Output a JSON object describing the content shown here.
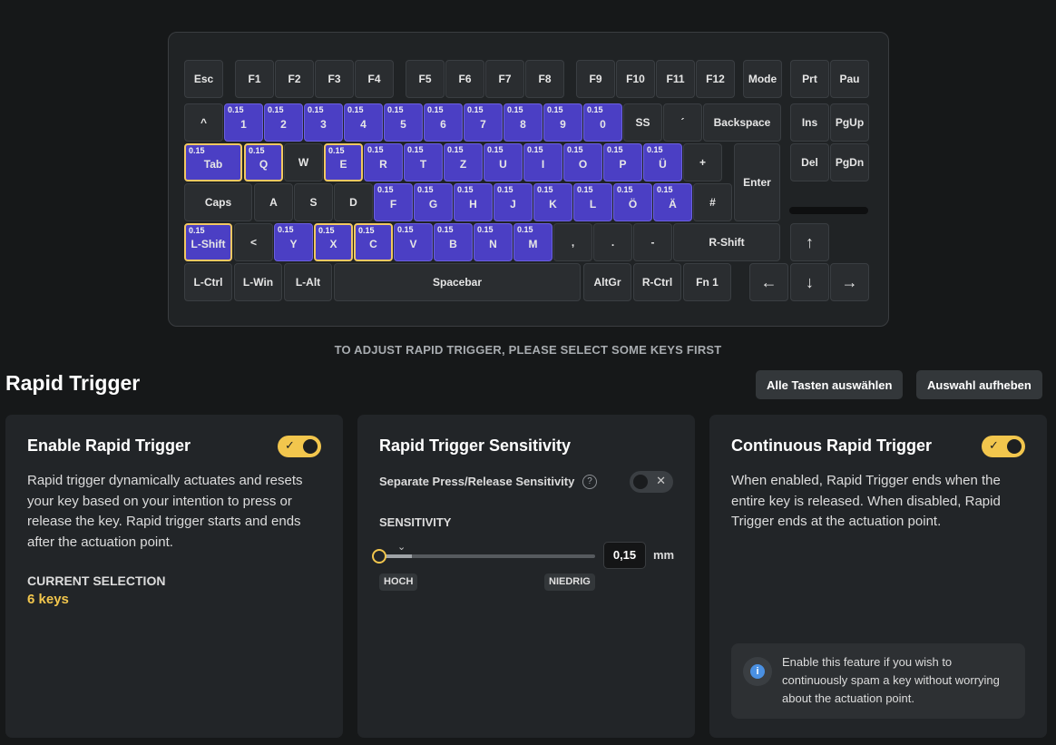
{
  "keyboard": {
    "rows": [
      [
        {
          "t": "Esc"
        },
        {
          "t": "F1"
        },
        {
          "t": "F2"
        },
        {
          "t": "F3"
        },
        {
          "t": "F4"
        },
        {
          "t": "F5"
        },
        {
          "t": "F6"
        },
        {
          "t": "F7"
        },
        {
          "t": "F8"
        },
        {
          "t": "F9"
        },
        {
          "t": "F10"
        },
        {
          "t": "F11"
        },
        {
          "t": "F12"
        },
        {
          "t": "Mode"
        },
        {
          "t": "Prt"
        },
        {
          "t": "Pau"
        }
      ],
      [
        {
          "t": "^"
        },
        {
          "t": "1",
          "v": "0.15"
        },
        {
          "t": "2",
          "v": "0.15"
        },
        {
          "t": "3",
          "v": "0.15"
        },
        {
          "t": "4",
          "v": "0.15"
        },
        {
          "t": "5",
          "v": "0.15"
        },
        {
          "t": "6",
          "v": "0.15"
        },
        {
          "t": "7",
          "v": "0.15"
        },
        {
          "t": "8",
          "v": "0.15"
        },
        {
          "t": "9",
          "v": "0.15"
        },
        {
          "t": "0",
          "v": "0.15"
        },
        {
          "t": "SS"
        },
        {
          "t": "´"
        },
        {
          "t": "Backspace"
        },
        {
          "t": "Ins"
        },
        {
          "t": "PgUp"
        }
      ],
      [
        {
          "t": "Tab",
          "v": "0.15",
          "s": true
        },
        {
          "t": "Q",
          "v": "0.15",
          "s": true
        },
        {
          "t": "W"
        },
        {
          "t": "E",
          "v": "0.15",
          "s": true
        },
        {
          "t": "R",
          "v": "0.15"
        },
        {
          "t": "T",
          "v": "0.15"
        },
        {
          "t": "Z",
          "v": "0.15"
        },
        {
          "t": "U",
          "v": "0.15"
        },
        {
          "t": "I",
          "v": "0.15"
        },
        {
          "t": "O",
          "v": "0.15"
        },
        {
          "t": "P",
          "v": "0.15"
        },
        {
          "t": "Ü",
          "v": "0.15"
        },
        {
          "t": "+"
        },
        {
          "t": "Enter"
        },
        {
          "t": "Del"
        },
        {
          "t": "PgDn"
        }
      ],
      [
        {
          "t": "Caps"
        },
        {
          "t": "A"
        },
        {
          "t": "S"
        },
        {
          "t": "D"
        },
        {
          "t": "F",
          "v": "0.15"
        },
        {
          "t": "G",
          "v": "0.15"
        },
        {
          "t": "H",
          "v": "0.15"
        },
        {
          "t": "J",
          "v": "0.15"
        },
        {
          "t": "K",
          "v": "0.15"
        },
        {
          "t": "L",
          "v": "0.15"
        },
        {
          "t": "Ö",
          "v": "0.15"
        },
        {
          "t": "Ä",
          "v": "0.15"
        },
        {
          "t": "#"
        }
      ],
      [
        {
          "t": "L-Shift",
          "v": "0.15",
          "s": true
        },
        {
          "t": "<"
        },
        {
          "t": "Y",
          "v": "0.15"
        },
        {
          "t": "X",
          "v": "0.15",
          "s": true
        },
        {
          "t": "C",
          "v": "0.15",
          "s": true
        },
        {
          "t": "V",
          "v": "0.15"
        },
        {
          "t": "B",
          "v": "0.15"
        },
        {
          "t": "N",
          "v": "0.15"
        },
        {
          "t": "M",
          "v": "0.15"
        },
        {
          "t": ","
        },
        {
          "t": "."
        },
        {
          "t": "-"
        },
        {
          "t": "R-Shift"
        },
        {
          "t": "↑"
        }
      ],
      [
        {
          "t": "L-Ctrl"
        },
        {
          "t": "L-Win"
        },
        {
          "t": "L-Alt"
        },
        {
          "t": "Spacebar"
        },
        {
          "t": "AltGr"
        },
        {
          "t": "R-Ctrl"
        },
        {
          "t": "Fn 1"
        },
        {
          "t": "←"
        },
        {
          "t": "↓"
        },
        {
          "t": "→"
        }
      ]
    ]
  },
  "notice": "TO ADJUST RAPID TRIGGER, PLEASE SELECT SOME KEYS FIRST",
  "header": {
    "title": "Rapid Trigger",
    "select_all": "Alle Tasten auswählen",
    "clear": "Auswahl aufheben"
  },
  "enable": {
    "title": "Enable Rapid Trigger",
    "on": true,
    "desc": "Rapid trigger dynamically actuates and resets your key based on your intention to press or release the key. Rapid trigger starts and ends after the actuation point.",
    "sel_label": "CURRENT SELECTION",
    "sel_value": "6 keys"
  },
  "sensitivity": {
    "title": "Rapid Trigger Sensitivity",
    "separate_label": "Separate Press/Release Sensitivity",
    "separate_on": false,
    "help": "?",
    "label": "SENSITIVITY",
    "value": "0,15",
    "unit": "mm",
    "low": "HOCH",
    "high": "NIEDRIG",
    "level": 0.0
  },
  "continuous": {
    "title": "Continuous Rapid Trigger",
    "on": true,
    "desc": "When enabled, Rapid Trigger ends when the entire key is released. When disabled, Rapid Trigger ends at the actuation point.",
    "info": "Enable this feature if you wish to continuously spam a key without worrying about the actuation point."
  },
  "colors": {
    "accent": "#f2c64d",
    "key_active": "#4b3fc4",
    "selected_border": "#f2c862"
  }
}
